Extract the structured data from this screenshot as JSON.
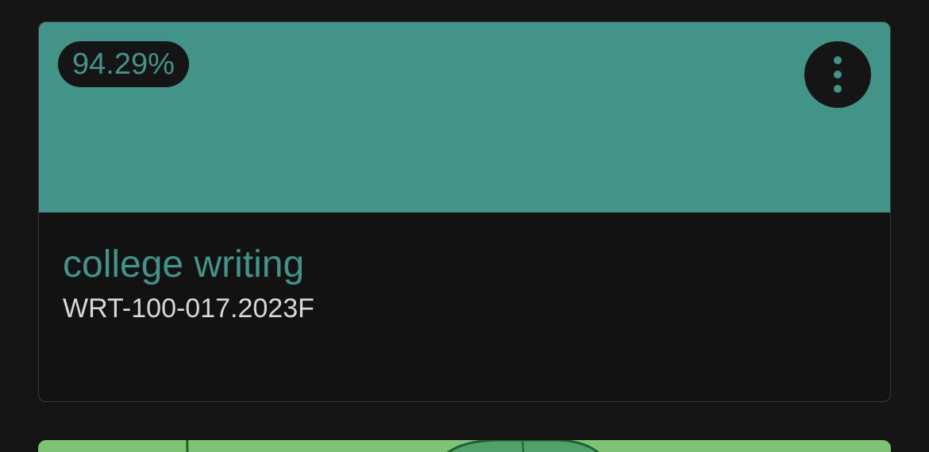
{
  "course_card": {
    "grade": "94.29%",
    "name": "college writing",
    "code": "WRT-100-017.2023F",
    "header_color": "#429488",
    "accent_text_color": "#429488",
    "menu_icon": "kebab-menu-icon"
  },
  "next_course_card": {
    "header_color": "#7dc275",
    "image": "partially visible illustrated header"
  }
}
